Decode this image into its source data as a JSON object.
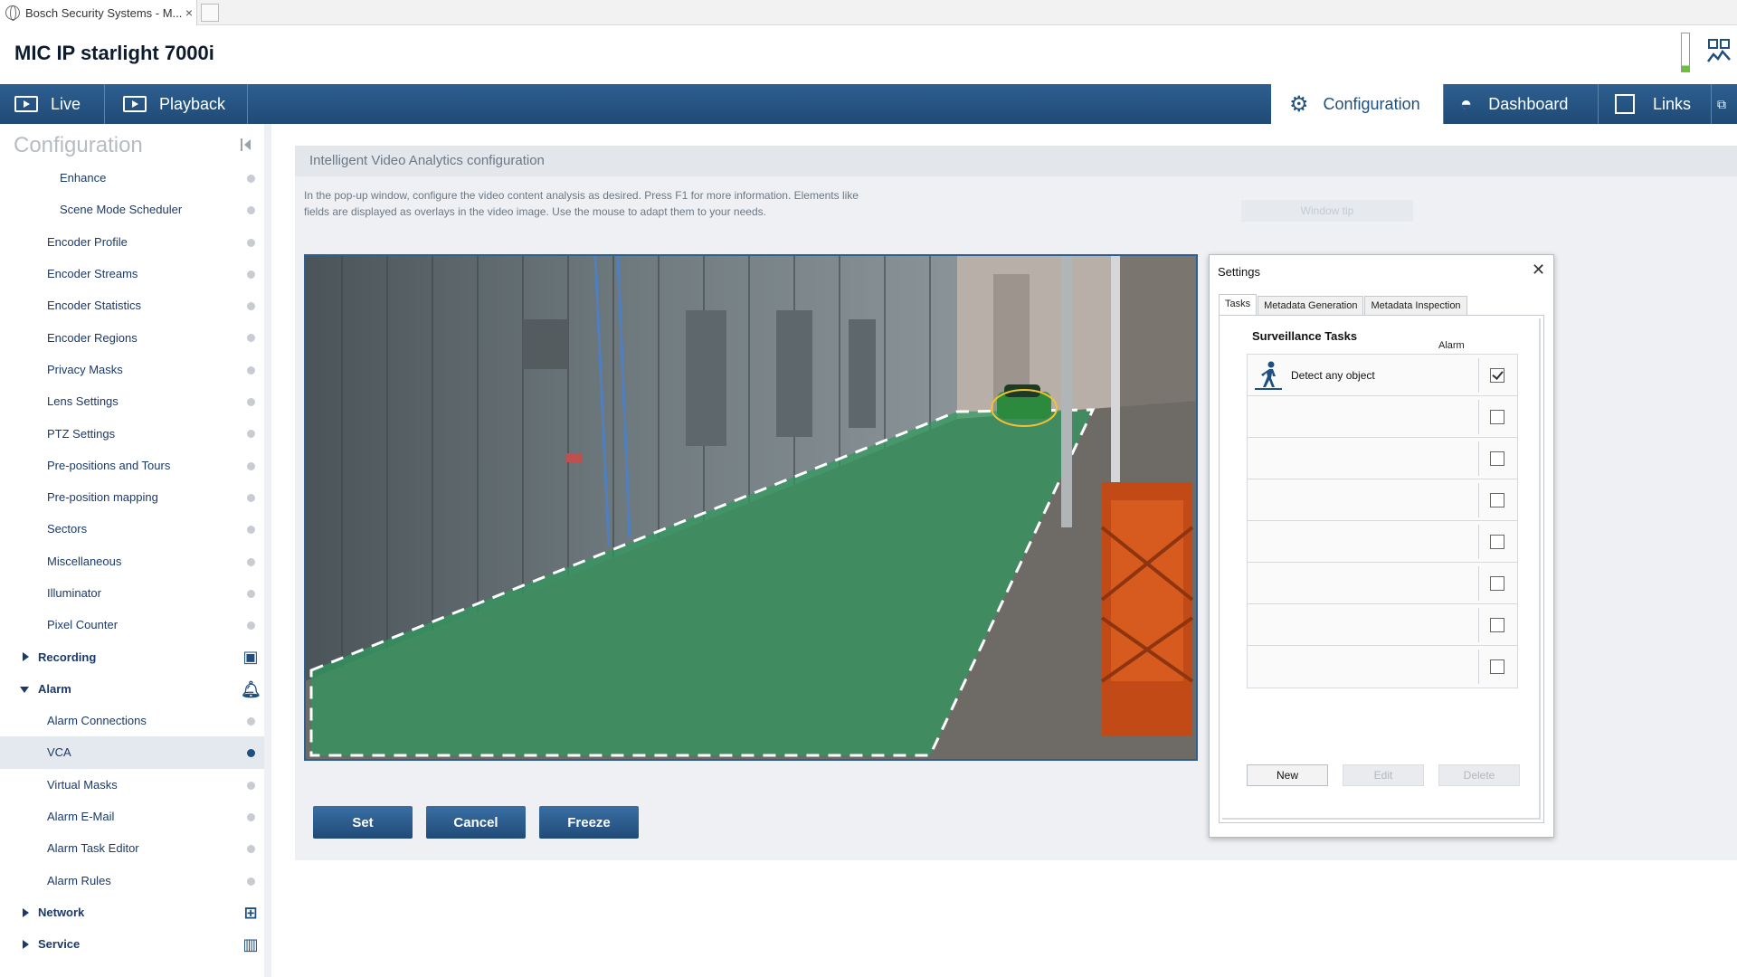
{
  "browser": {
    "tab_title": "Bosch Security Systems - M...",
    "tab_close": "×"
  },
  "header": {
    "device_title": "MIC IP starlight 7000i"
  },
  "nav": {
    "live": "Live",
    "playback": "Playback",
    "configuration": "Configuration",
    "dashboard": "Dashboard",
    "links": "Links"
  },
  "sidebar": {
    "title": "Configuration",
    "items": [
      {
        "label": "Enhance"
      },
      {
        "label": "Scene Mode Scheduler"
      },
      {
        "label": "Encoder Profile"
      },
      {
        "label": "Encoder Streams"
      },
      {
        "label": "Encoder Statistics"
      },
      {
        "label": "Encoder Regions"
      },
      {
        "label": "Privacy Masks"
      },
      {
        "label": "Lens Settings"
      },
      {
        "label": "PTZ Settings"
      },
      {
        "label": "Pre-positions and Tours"
      },
      {
        "label": "Pre-position mapping"
      },
      {
        "label": "Sectors"
      },
      {
        "label": "Miscellaneous"
      },
      {
        "label": "Illuminator"
      },
      {
        "label": "Pixel Counter"
      },
      {
        "label": "Recording"
      },
      {
        "label": "Alarm"
      },
      {
        "label": "Alarm Connections"
      },
      {
        "label": "VCA"
      },
      {
        "label": "Virtual Masks"
      },
      {
        "label": "Alarm E-Mail"
      },
      {
        "label": "Alarm Task Editor"
      },
      {
        "label": "Alarm Rules"
      },
      {
        "label": "Network"
      },
      {
        "label": "Service"
      }
    ]
  },
  "main": {
    "panel_title": "Intelligent Video Analytics configuration",
    "description": "In the pop-up window, configure the video content analysis as desired. Press F1 for more information. Elements like fields are displayed as overlays in the video image. Use the mouse to adapt them to your needs.",
    "window_tip": "Window tip",
    "buttons": {
      "set": "Set",
      "cancel": "Cancel",
      "freeze": "Freeze"
    }
  },
  "dialog": {
    "title": "Settings",
    "close": "✕",
    "tabs": [
      "Tasks",
      "Metadata Generation",
      "Metadata Inspection"
    ],
    "section_title": "Surveillance Tasks",
    "alarm_header": "Alarm",
    "tasks": [
      {
        "label": "Detect any object",
        "alarm": true
      },
      {
        "label": "",
        "alarm": false
      },
      {
        "label": "",
        "alarm": false
      },
      {
        "label": "",
        "alarm": false
      },
      {
        "label": "",
        "alarm": false
      },
      {
        "label": "",
        "alarm": false
      },
      {
        "label": "",
        "alarm": false
      },
      {
        "label": "",
        "alarm": false
      }
    ],
    "buttons": {
      "new": "New",
      "edit": "Edit",
      "delete": "Delete"
    }
  },
  "colors": {
    "nav_blue": "#1f4a76",
    "accent_blue": "#2e5f90",
    "zone_green": "#2f9a5e"
  }
}
